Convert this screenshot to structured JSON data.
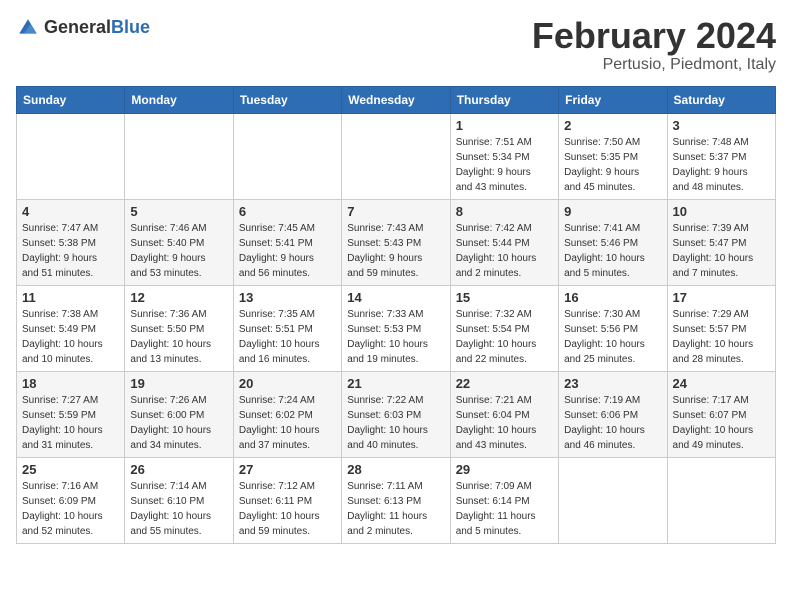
{
  "logo": {
    "text_general": "General",
    "text_blue": "Blue"
  },
  "title": {
    "month_year": "February 2024",
    "location": "Pertusio, Piedmont, Italy"
  },
  "headers": [
    "Sunday",
    "Monday",
    "Tuesday",
    "Wednesday",
    "Thursday",
    "Friday",
    "Saturday"
  ],
  "weeks": [
    [
      {
        "day": "",
        "info": ""
      },
      {
        "day": "",
        "info": ""
      },
      {
        "day": "",
        "info": ""
      },
      {
        "day": "",
        "info": ""
      },
      {
        "day": "1",
        "info": "Sunrise: 7:51 AM\nSunset: 5:34 PM\nDaylight: 9 hours\nand 43 minutes."
      },
      {
        "day": "2",
        "info": "Sunrise: 7:50 AM\nSunset: 5:35 PM\nDaylight: 9 hours\nand 45 minutes."
      },
      {
        "day": "3",
        "info": "Sunrise: 7:48 AM\nSunset: 5:37 PM\nDaylight: 9 hours\nand 48 minutes."
      }
    ],
    [
      {
        "day": "4",
        "info": "Sunrise: 7:47 AM\nSunset: 5:38 PM\nDaylight: 9 hours\nand 51 minutes."
      },
      {
        "day": "5",
        "info": "Sunrise: 7:46 AM\nSunset: 5:40 PM\nDaylight: 9 hours\nand 53 minutes."
      },
      {
        "day": "6",
        "info": "Sunrise: 7:45 AM\nSunset: 5:41 PM\nDaylight: 9 hours\nand 56 minutes."
      },
      {
        "day": "7",
        "info": "Sunrise: 7:43 AM\nSunset: 5:43 PM\nDaylight: 9 hours\nand 59 minutes."
      },
      {
        "day": "8",
        "info": "Sunrise: 7:42 AM\nSunset: 5:44 PM\nDaylight: 10 hours\nand 2 minutes."
      },
      {
        "day": "9",
        "info": "Sunrise: 7:41 AM\nSunset: 5:46 PM\nDaylight: 10 hours\nand 5 minutes."
      },
      {
        "day": "10",
        "info": "Sunrise: 7:39 AM\nSunset: 5:47 PM\nDaylight: 10 hours\nand 7 minutes."
      }
    ],
    [
      {
        "day": "11",
        "info": "Sunrise: 7:38 AM\nSunset: 5:49 PM\nDaylight: 10 hours\nand 10 minutes."
      },
      {
        "day": "12",
        "info": "Sunrise: 7:36 AM\nSunset: 5:50 PM\nDaylight: 10 hours\nand 13 minutes."
      },
      {
        "day": "13",
        "info": "Sunrise: 7:35 AM\nSunset: 5:51 PM\nDaylight: 10 hours\nand 16 minutes."
      },
      {
        "day": "14",
        "info": "Sunrise: 7:33 AM\nSunset: 5:53 PM\nDaylight: 10 hours\nand 19 minutes."
      },
      {
        "day": "15",
        "info": "Sunrise: 7:32 AM\nSunset: 5:54 PM\nDaylight: 10 hours\nand 22 minutes."
      },
      {
        "day": "16",
        "info": "Sunrise: 7:30 AM\nSunset: 5:56 PM\nDaylight: 10 hours\nand 25 minutes."
      },
      {
        "day": "17",
        "info": "Sunrise: 7:29 AM\nSunset: 5:57 PM\nDaylight: 10 hours\nand 28 minutes."
      }
    ],
    [
      {
        "day": "18",
        "info": "Sunrise: 7:27 AM\nSunset: 5:59 PM\nDaylight: 10 hours\nand 31 minutes."
      },
      {
        "day": "19",
        "info": "Sunrise: 7:26 AM\nSunset: 6:00 PM\nDaylight: 10 hours\nand 34 minutes."
      },
      {
        "day": "20",
        "info": "Sunrise: 7:24 AM\nSunset: 6:02 PM\nDaylight: 10 hours\nand 37 minutes."
      },
      {
        "day": "21",
        "info": "Sunrise: 7:22 AM\nSunset: 6:03 PM\nDaylight: 10 hours\nand 40 minutes."
      },
      {
        "day": "22",
        "info": "Sunrise: 7:21 AM\nSunset: 6:04 PM\nDaylight: 10 hours\nand 43 minutes."
      },
      {
        "day": "23",
        "info": "Sunrise: 7:19 AM\nSunset: 6:06 PM\nDaylight: 10 hours\nand 46 minutes."
      },
      {
        "day": "24",
        "info": "Sunrise: 7:17 AM\nSunset: 6:07 PM\nDaylight: 10 hours\nand 49 minutes."
      }
    ],
    [
      {
        "day": "25",
        "info": "Sunrise: 7:16 AM\nSunset: 6:09 PM\nDaylight: 10 hours\nand 52 minutes."
      },
      {
        "day": "26",
        "info": "Sunrise: 7:14 AM\nSunset: 6:10 PM\nDaylight: 10 hours\nand 55 minutes."
      },
      {
        "day": "27",
        "info": "Sunrise: 7:12 AM\nSunset: 6:11 PM\nDaylight: 10 hours\nand 59 minutes."
      },
      {
        "day": "28",
        "info": "Sunrise: 7:11 AM\nSunset: 6:13 PM\nDaylight: 11 hours\nand 2 minutes."
      },
      {
        "day": "29",
        "info": "Sunrise: 7:09 AM\nSunset: 6:14 PM\nDaylight: 11 hours\nand 5 minutes."
      },
      {
        "day": "",
        "info": ""
      },
      {
        "day": "",
        "info": ""
      }
    ]
  ]
}
